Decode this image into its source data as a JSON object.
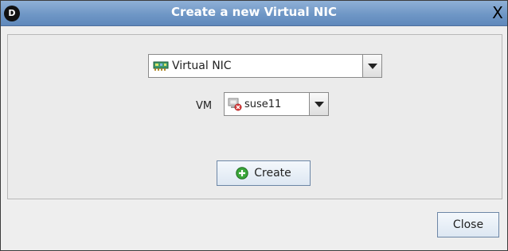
{
  "window": {
    "title": "Create a new Virtual NIC",
    "logo_letter": "D",
    "close_glyph": "X"
  },
  "form": {
    "type_select": {
      "selected": "Virtual NIC",
      "icon": "network-card-icon"
    },
    "vm_label": "VM",
    "vm_select": {
      "selected": "suse11",
      "icon": "vm-stopped-icon"
    },
    "create_label": "Create",
    "create_icon": "add-icon"
  },
  "footer": {
    "close_label": "Close"
  },
  "colors": {
    "titlebar": "#6f97c6",
    "title_text": "#ffffff",
    "create_icon": "#3aa63a",
    "vm_error": "#d93a3a"
  }
}
